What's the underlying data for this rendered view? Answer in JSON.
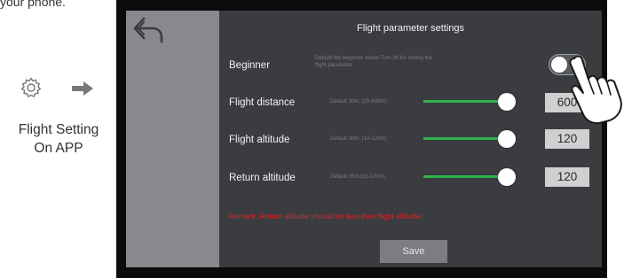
{
  "left_panel": {
    "cut_text": "your phone.",
    "gear_icon": "gear-icon",
    "arrow_icon": "arrow-right-icon",
    "label_line1": "Flight Setting",
    "label_line2": "On APP"
  },
  "app": {
    "back_icon": "back-arrow-icon",
    "title": "Flight parameter settings",
    "beginner": {
      "label": "Beginner",
      "hint_line1": "Default the beginner model Turn off for setting the",
      "hint_line2": "flight parameter",
      "toggle_on": true
    },
    "flight_distance": {
      "label": "Flight distance",
      "hint": "Default 30m, (20-600m)",
      "value": "600",
      "slider_fraction": 1.0
    },
    "flight_altitude": {
      "label": "Flight altitude",
      "hint": "Default 30m, (10-120m)",
      "value": "120",
      "slider_fraction": 1.0
    },
    "return_altitude": {
      "label": "Return altitude",
      "hint": "Default 25m,(10-120m)",
      "value": "120",
      "slider_fraction": 1.0
    },
    "remark": "Remark: Return altitude should be less than flight altitude!",
    "save_label": "Save"
  },
  "colors": {
    "screen_bg": "#3a3c40",
    "sidebar_bg": "#88898c",
    "slider_track": "#2fb34a",
    "remark_text": "#d8282a",
    "value_box_bg": "#cfd0d2",
    "save_bg": "#7b7d81"
  }
}
